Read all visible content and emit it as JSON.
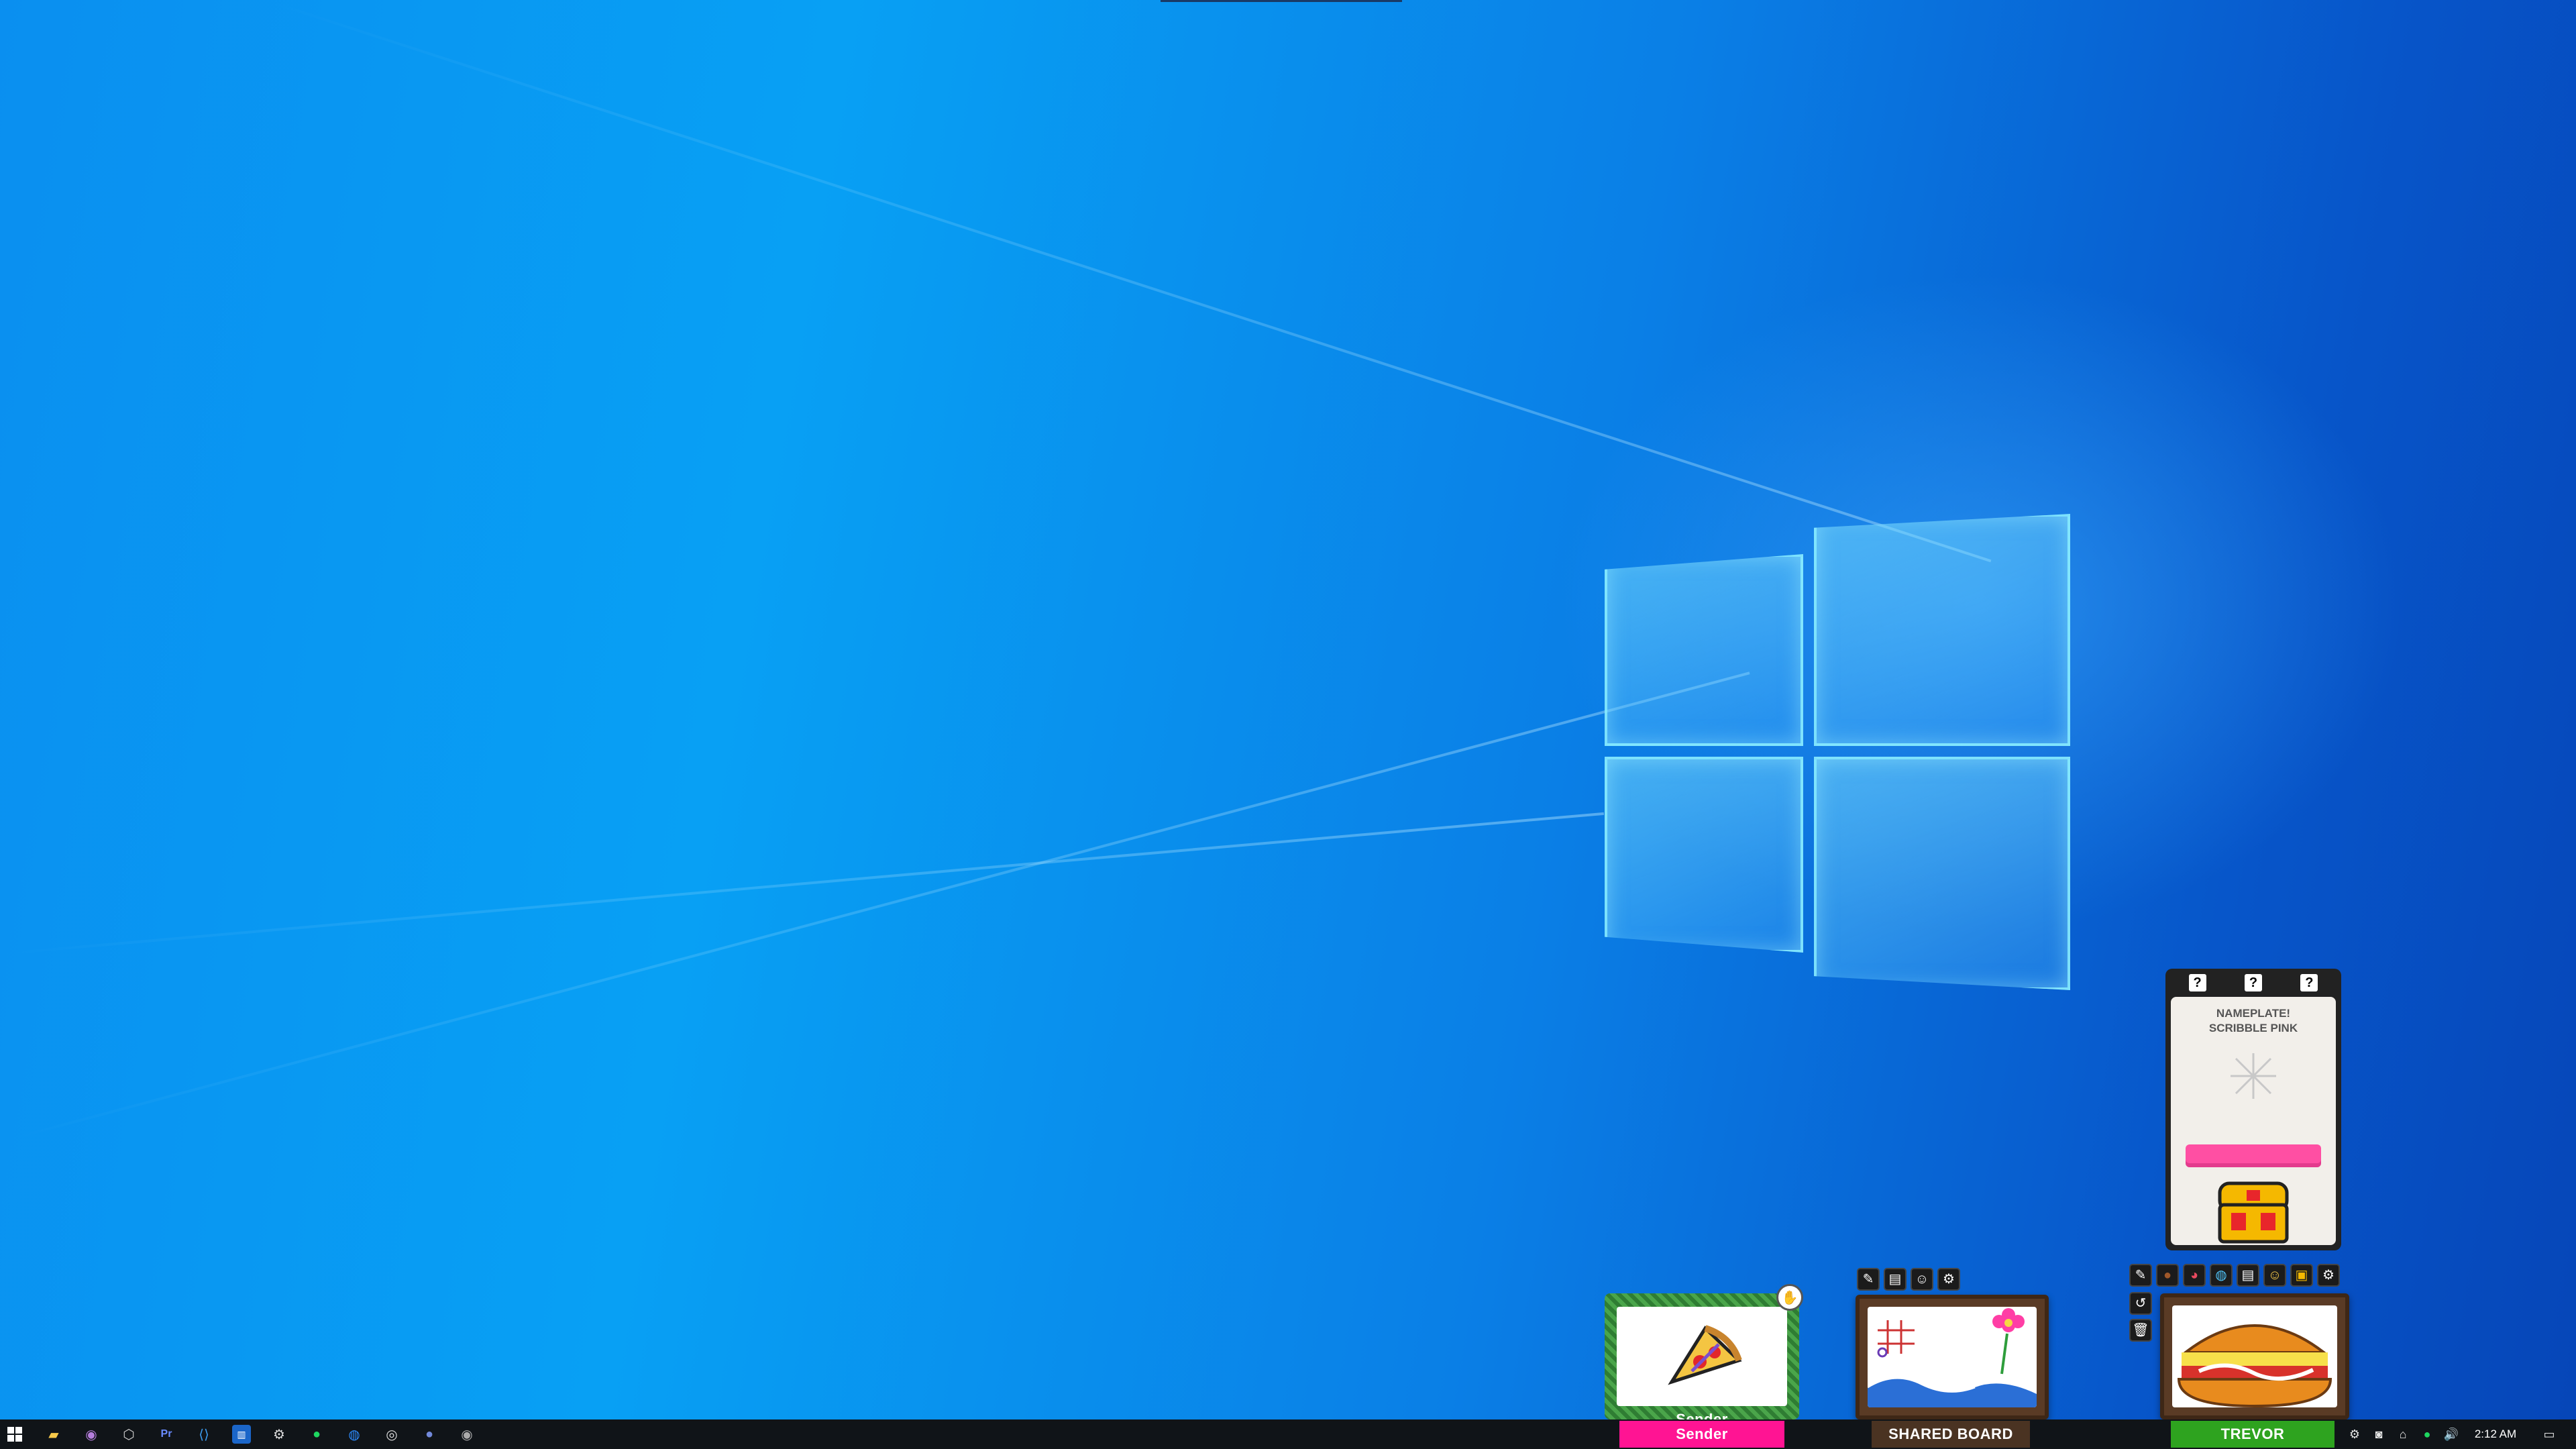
{
  "desktop": {
    "wallpaper": "windows-hero-light",
    "accent_color": "#0a8ff0"
  },
  "widgets": {
    "sender": {
      "label": "Sender",
      "label_color": "#ff1493",
      "content_icon": "pizza-slice-icon",
      "badge_icon": "heart-hand-icon"
    },
    "shared_board": {
      "label": "SHARED BOARD",
      "label_color": "#4a3322",
      "content_icon": "doodle-flower-icon"
    },
    "trevor": {
      "label": "TREVOR",
      "label_color": "#2ea31f",
      "content_icon": "burger-icon"
    },
    "nameplate_card": {
      "top_marks": [
        "?",
        "?",
        "?"
      ],
      "title_line1": "NAMEPLATE!",
      "title_line2": "SCRIBBLE PINK",
      "card_color": "#ff4fa3",
      "chest_icon": "treasure-chest-icon"
    }
  },
  "taskbar": {
    "pinned_icons": [
      "windows-start-icon",
      "file-explorer-icon",
      "github-desktop-icon",
      "unity-icon",
      "premiere-icon",
      "vscode-icon",
      "trello-icon",
      "steam-icon",
      "spotify-icon",
      "zoom-icon",
      "chrome-icon",
      "discord-icon",
      "obs-icon"
    ],
    "tray_icons": [
      "steam-tray-icon",
      "discord-tray-icon",
      "network-icon",
      "spotify-tray-icon",
      "volume-icon"
    ],
    "clock": "2:12 AM",
    "notification_icon": "notification-icon"
  }
}
